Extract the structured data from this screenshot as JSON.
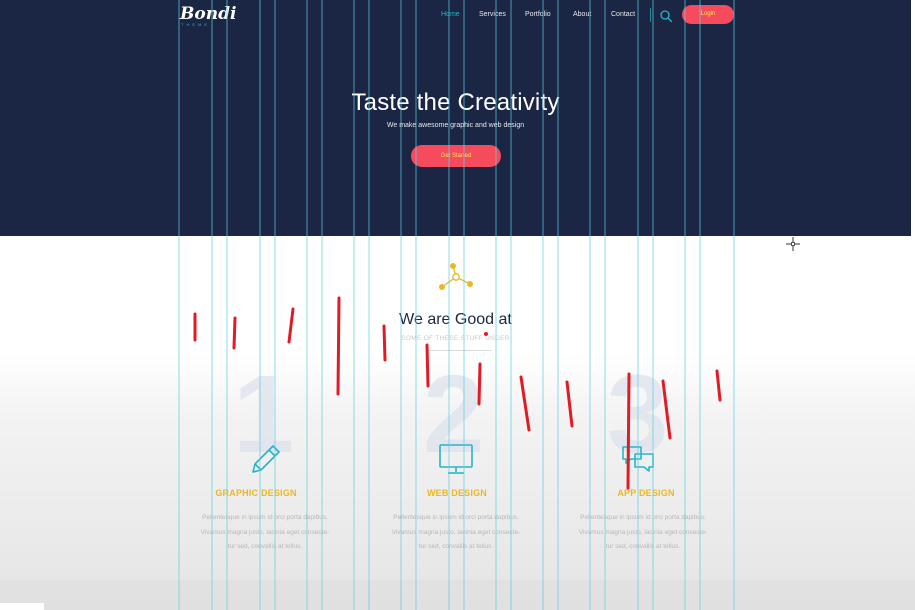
{
  "colors": {
    "hero_bg": "#1b2644",
    "accent_teal": "#27b6c8",
    "accent_red": "#f64b5c",
    "accent_yellow": "#ebb727",
    "annotation_red": "#e11b26"
  },
  "logo": {
    "name": "Bondi",
    "tagline": "THEME"
  },
  "nav": {
    "items": [
      {
        "label": "Home",
        "active": true
      },
      {
        "label": "Services",
        "active": false
      },
      {
        "label": "Portfolio",
        "active": false
      },
      {
        "label": "About",
        "active": false
      },
      {
        "label": "Contact",
        "active": false
      }
    ],
    "search_icon": "search-icon",
    "login_label": "Login"
  },
  "hero": {
    "title": "Taste the Creativity",
    "subtitle": "We make awesome graphic and web design",
    "cta_label": "Get Started"
  },
  "section": {
    "icon": "network-icon",
    "title": "We are Good at",
    "subtitle": "SOME OF THESE STUFF UNDER"
  },
  "services": [
    {
      "number": "1",
      "icon": "pencil-icon",
      "title": "GRAPHIC DESIGN",
      "desc_lines": [
        "Pellentesque in ipsum id orci porta dapibus.",
        "Vivamus magna justo, lacinia eget consecte-",
        "tur sed, convallis at tellus."
      ]
    },
    {
      "number": "2",
      "icon": "monitor-icon",
      "title": "WEB DESIGN",
      "desc_lines": [
        "Pellentesque in ipsum id orci porta dapibus.",
        "Vivamus magna justo, lacinia eget consecte-",
        "tur sed, convallis at tellus."
      ]
    },
    {
      "number": "3",
      "icon": "chat-icon",
      "title": "APP DESIGN",
      "desc_lines": [
        "Pellentesque in ipsum id orci porta dapibus.",
        "Vivamus magna justo, lacinia eget consecte-",
        "tur sed, convallis at tellus."
      ]
    }
  ]
}
